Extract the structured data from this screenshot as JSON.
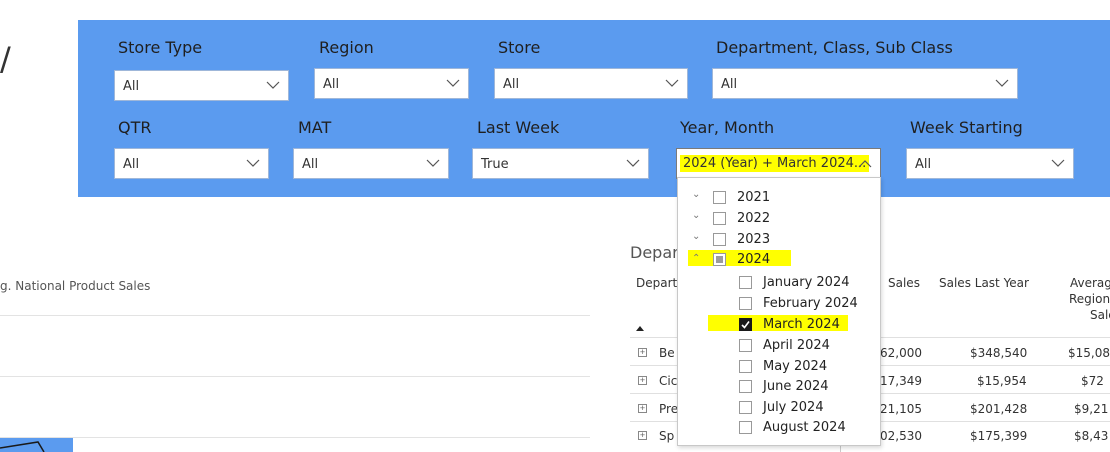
{
  "page": {
    "slash": "/"
  },
  "filters": {
    "store_type": {
      "label": "Store Type",
      "value": "All"
    },
    "region": {
      "label": "Region",
      "value": "All"
    },
    "store": {
      "label": "Store",
      "value": "All"
    },
    "department": {
      "label": "Department, Class, Sub Class",
      "value": "All"
    },
    "qtr": {
      "label": "QTR",
      "value": "All"
    },
    "mat": {
      "label": "MAT",
      "value": "All"
    },
    "last_week": {
      "label": "Last Week",
      "value": "True"
    },
    "year_month": {
      "label": "Year, Month",
      "value": "2024 (Year) + March 2024..."
    },
    "week_starting": {
      "label": "Week Starting",
      "value": "All"
    }
  },
  "left_visual": {
    "partial_title": "g. National Product Sales"
  },
  "table": {
    "title_partial": "Depar",
    "headers": {
      "department": "Depart",
      "sales": "Sales",
      "sales_last_year": "Sales Last Year",
      "avg_region_line1": "Averag",
      "avg_region_line2": "Region",
      "avg_region_line3": "Sale"
    },
    "rows": [
      {
        "name": "Be",
        "sales": "62,000",
        "sales_ly": "$348,540",
        "avg": "$15,08"
      },
      {
        "name": "Cic",
        "sales": "17,349",
        "sales_ly": "$15,954",
        "avg": "$72"
      },
      {
        "name": "Pre",
        "sales": "21,105",
        "sales_ly": "$201,428",
        "avg": "$9,21"
      },
      {
        "name": "Sp",
        "sales": "02,530",
        "sales_ly": "$175,399",
        "avg": "$8,43"
      }
    ]
  },
  "year_month_popup": {
    "years": [
      {
        "label": "2021",
        "state": "unchecked",
        "expanded": false
      },
      {
        "label": "2022",
        "state": "unchecked",
        "expanded": false
      },
      {
        "label": "2023",
        "state": "unchecked",
        "expanded": false
      },
      {
        "label": "2024",
        "state": "partial",
        "expanded": true
      }
    ],
    "months": [
      {
        "label": "January 2024",
        "checked": false
      },
      {
        "label": "February 2024",
        "checked": false
      },
      {
        "label": "March 2024",
        "checked": true
      },
      {
        "label": "April 2024",
        "checked": false
      },
      {
        "label": "May 2024",
        "checked": false
      },
      {
        "label": "June 2024",
        "checked": false
      },
      {
        "label": "July 2024",
        "checked": false
      },
      {
        "label": "August 2024",
        "checked": false
      }
    ]
  },
  "colors": {
    "panel": "#5b9bef",
    "highlight": "#ffff00"
  }
}
